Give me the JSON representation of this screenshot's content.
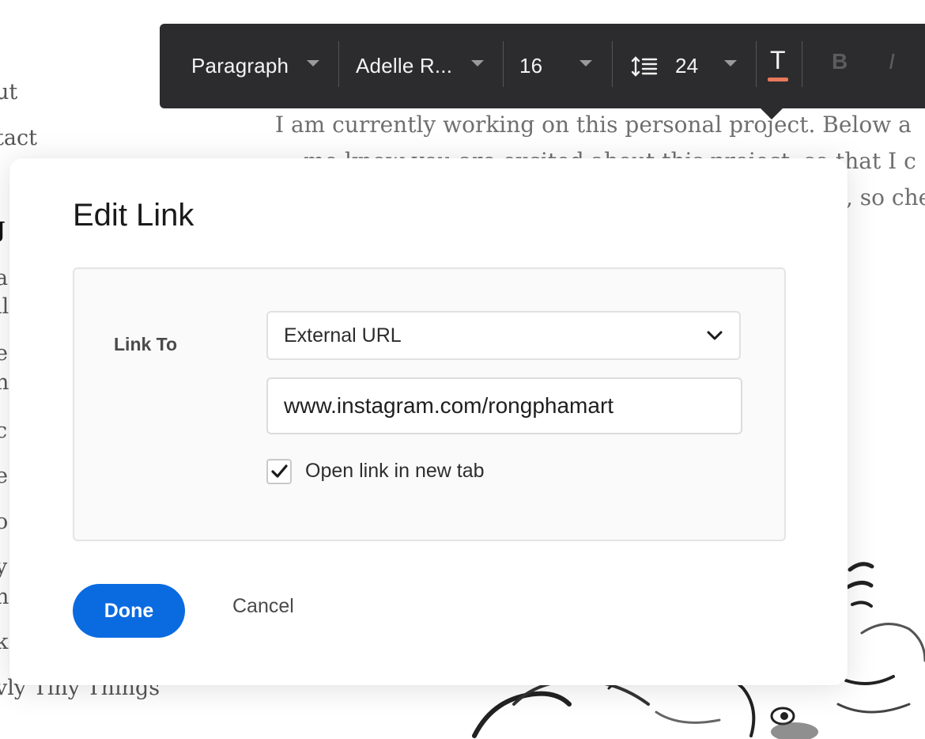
{
  "background": {
    "nav_items": [
      "ut",
      "tact",
      "J",
      "a",
      "ıl",
      "e",
      "n)",
      "c",
      "e",
      "o",
      "y",
      "ni",
      "k",
      "vly Tiny Things"
    ],
    "text_lines": [
      "I am currently working on this personal project. Below a",
      "me know you are excited about this project, so that I c",
      ", so che"
    ]
  },
  "toolbar": {
    "paragraph_style": "Paragraph",
    "font_name": "Adelle R...",
    "font_size": "16",
    "line_height": "24",
    "text_color_icon": "T",
    "bold_icon": "B",
    "italic_icon": "I",
    "text_color": "#e8795a"
  },
  "dialog": {
    "title": "Edit Link",
    "link_to_label": "Link To",
    "link_type": "External URL",
    "url_value": "www.instagram.com/rongphamart",
    "open_new_tab_label": "Open link in new tab",
    "open_new_tab_checked": true,
    "done_label": "Done",
    "cancel_label": "Cancel",
    "accent_color": "#0a6be0"
  }
}
